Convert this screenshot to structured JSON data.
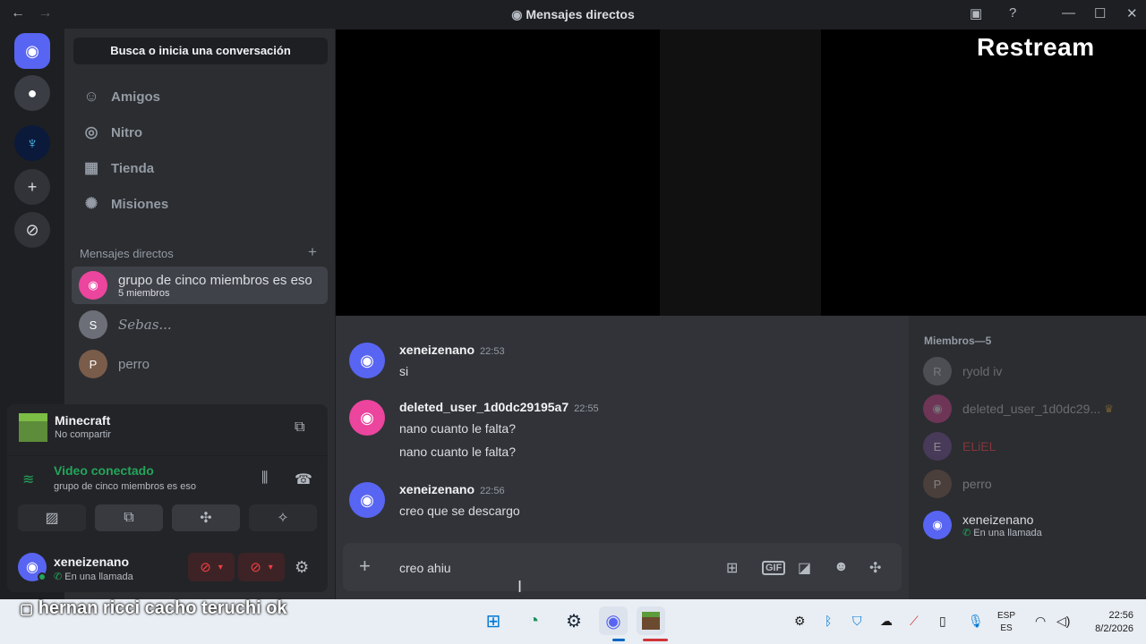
{
  "window": {
    "title": "Mensajes directos"
  },
  "sidebar": {
    "search_label": "Busca o inicia una conversación",
    "nav": [
      {
        "label": "Amigos",
        "icon": "friends-icon"
      },
      {
        "label": "Nitro",
        "icon": "nitro-icon"
      },
      {
        "label": "Tienda",
        "icon": "shop-icon"
      },
      {
        "label": "Misiones",
        "icon": "quests-icon"
      }
    ],
    "dm_header": "Mensajes directos",
    "dms": [
      {
        "name": "grupo de cinco miembros es eso",
        "sub": "5 miembros"
      },
      {
        "name": "Sebas...",
        "sub": ""
      },
      {
        "name": "perro",
        "sub": ""
      }
    ]
  },
  "panel": {
    "activity_title": "Minecraft",
    "activity_sub": "No compartir",
    "voice_status": "Video conectado",
    "voice_channel": "grupo de cinco miembros es eso",
    "user_name": "xeneizenano",
    "user_status": "En una llamada"
  },
  "video": {
    "brand": "Restream"
  },
  "chat": {
    "messages": [
      {
        "author": "xeneizenano",
        "time": "22:53",
        "lines": [
          "si"
        ]
      },
      {
        "author": "deleted_user_1d0dc29195a7",
        "time": "22:55",
        "lines": [
          "nano cuanto le falta?",
          "nano cuanto le falta?"
        ]
      },
      {
        "author": "xeneizenano",
        "time": "22:56",
        "lines": [
          "creo que se descargo"
        ]
      }
    ],
    "composer_value": "creo ahiu"
  },
  "members": {
    "header": "Miembros—5",
    "list": [
      {
        "name": "ryold iv",
        "status": ""
      },
      {
        "name": "deleted_user_1d0dc29...",
        "status": ""
      },
      {
        "name": "ELiEL",
        "status": ""
      },
      {
        "name": "perro",
        "status": ""
      },
      {
        "name": "xeneizenano",
        "status": "En una llamada"
      }
    ]
  },
  "caption": "hernan ricci cacho teruchi ok",
  "taskbar": {
    "lang_top": "ESP",
    "lang_bottom": "ES",
    "time": "22:56",
    "date": "8/2/2026"
  },
  "colors": {
    "blurple": "#5865f2",
    "green": "#23a55a",
    "pink": "#eb459e",
    "red": "#f23f43"
  }
}
